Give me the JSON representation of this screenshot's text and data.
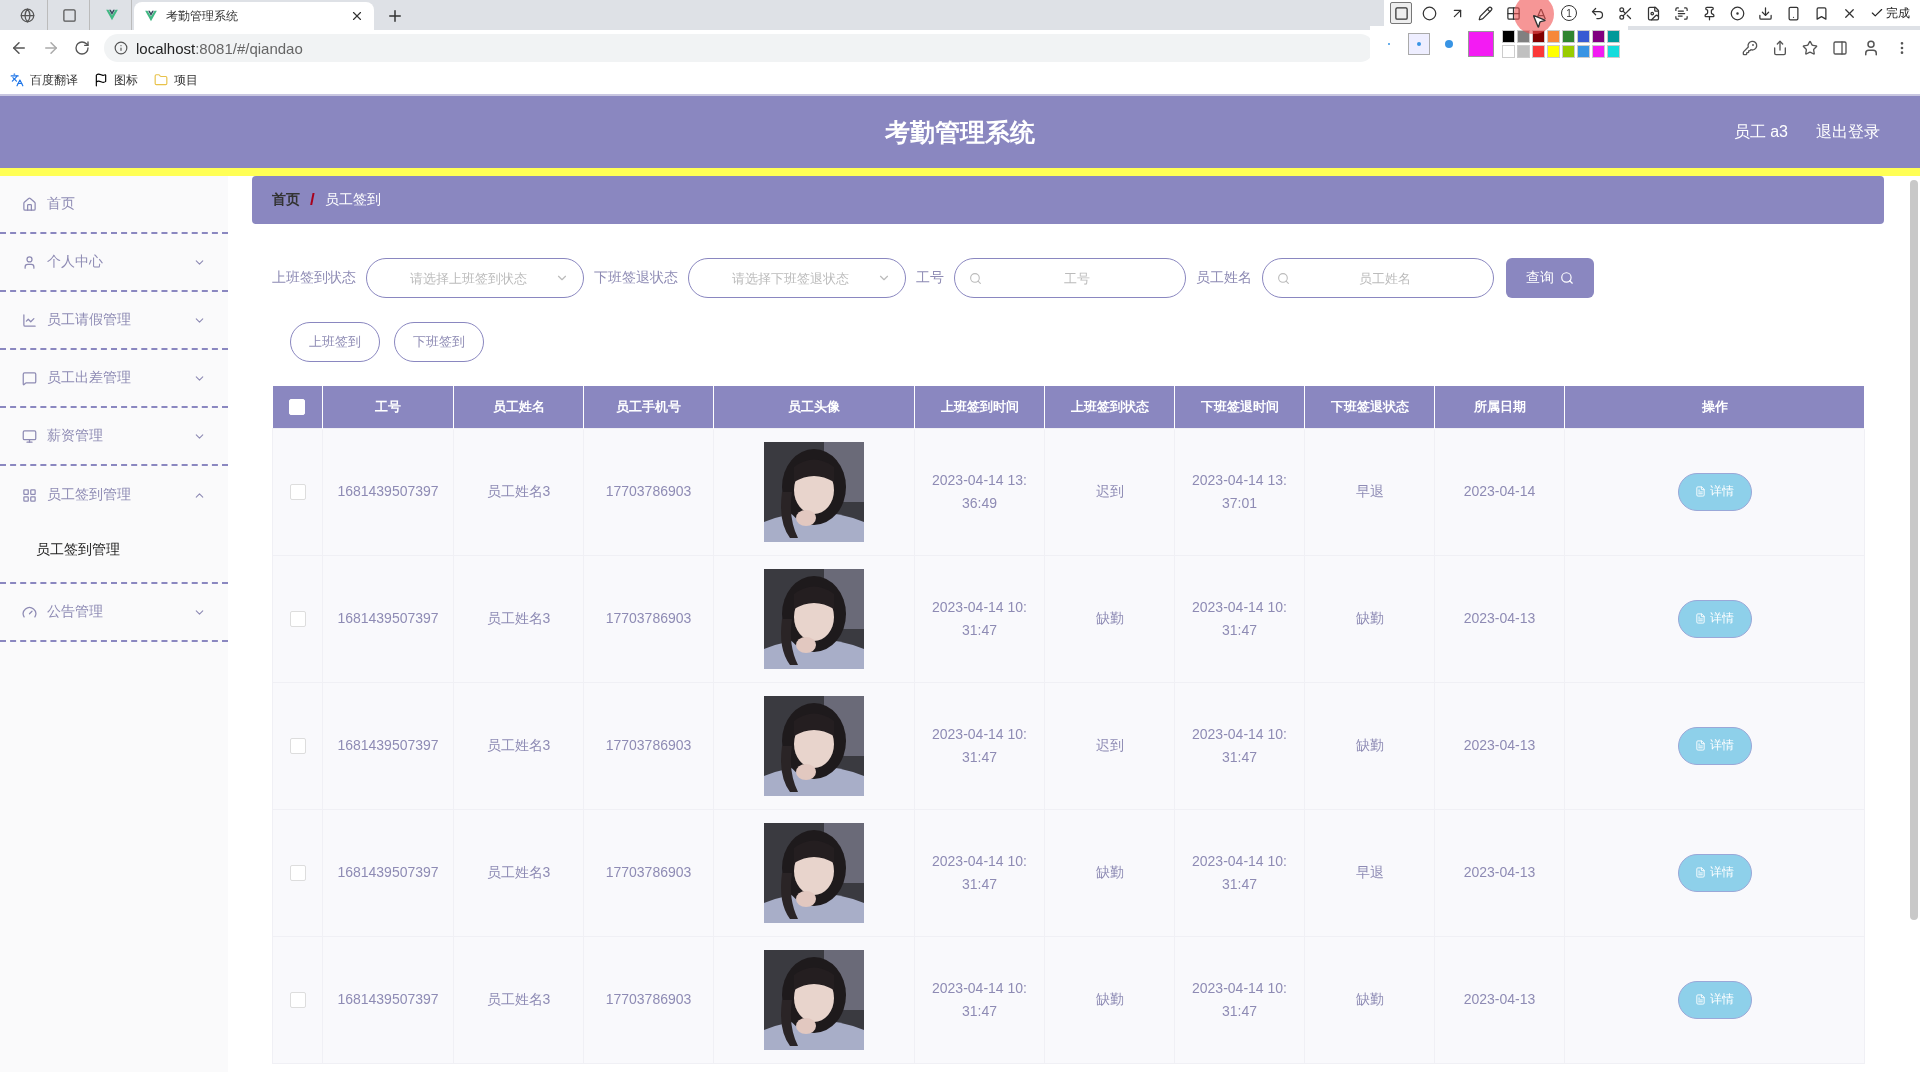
{
  "browser": {
    "tabs": [
      {
        "kind": "globe",
        "selected": false
      },
      {
        "kind": "blank",
        "selected": false
      },
      {
        "kind": "vue",
        "selected": false
      },
      {
        "kind": "vue",
        "title": "考勤管理系统",
        "selected": true
      }
    ],
    "url_host": "localhost",
    "url_rest": ":8081/#/qiandao",
    "bookmarks": [
      {
        "kind": "translate",
        "label": "百度翻译"
      },
      {
        "kind": "flag",
        "label": "图标"
      },
      {
        "kind": "folder",
        "label": "项目"
      }
    ]
  },
  "capture_tool": {
    "tools": [
      {
        "kind": "rect",
        "selected": true
      },
      {
        "kind": "circle",
        "selected": false
      },
      {
        "kind": "arrow",
        "selected": false
      },
      {
        "kind": "pen",
        "selected": false
      },
      {
        "kind": "mosaic",
        "selected": false
      },
      {
        "kind": "text",
        "glyph": "A",
        "selected": false
      },
      {
        "kind": "counter",
        "glyph": "1",
        "selected": false
      },
      {
        "kind": "undo",
        "selected": false
      },
      {
        "kind": "cut",
        "selected": false
      },
      {
        "kind": "ocr",
        "selected": false
      },
      {
        "kind": "scan",
        "selected": false
      },
      {
        "kind": "pin",
        "selected": false
      },
      {
        "kind": "record",
        "selected": false
      },
      {
        "kind": "save",
        "selected": false
      },
      {
        "kind": "phone",
        "selected": false
      },
      {
        "kind": "bookmark",
        "selected": false
      },
      {
        "kind": "close",
        "selected": false
      }
    ],
    "done_label": "完成",
    "sizes": [
      {
        "selected": false
      },
      {
        "selected": true
      },
      {
        "selected": false
      }
    ],
    "palette": [
      {
        "color": "#000000"
      },
      {
        "color": "#808080"
      },
      {
        "color": "#800000"
      },
      {
        "color": "#f7883a"
      },
      {
        "color": "#308430"
      },
      {
        "color": "#385ad3"
      },
      {
        "color": "#800080"
      },
      {
        "color": "#009999"
      },
      {
        "color": "#ffffff"
      },
      {
        "color": "#c0c0c0"
      },
      {
        "color": "#fb3838"
      },
      {
        "color": "#ffff00"
      },
      {
        "color": "#99cc00"
      },
      {
        "color": "#3894e4"
      },
      {
        "color": "#f31bf3",
        "selected": true
      },
      {
        "color": "#16dcdc"
      }
    ]
  },
  "header": {
    "title": "考勤管理系统",
    "user": "员工 a3",
    "logout": "退出登录"
  },
  "sidebar": {
    "items": [
      {
        "kind": "home",
        "label": "首页"
      },
      {
        "kind": "user",
        "label": "个人中心",
        "expanded": false
      },
      {
        "kind": "chart",
        "label": "员工请假管理",
        "expanded": false
      },
      {
        "kind": "chat",
        "label": "员工出差管理",
        "expanded": false
      },
      {
        "kind": "monitor",
        "label": "薪资管理",
        "expanded": false
      },
      {
        "kind": "grid",
        "label": "员工签到管理",
        "expanded": true,
        "children": [
          {
            "label": "员工签到管理"
          }
        ]
      },
      {
        "kind": "gauge",
        "label": "公告管理",
        "expanded": false
      }
    ]
  },
  "breadcrumb": [
    "首页",
    "员工签到"
  ],
  "breadcrumb_separator": "/",
  "filters": [
    {
      "kind": "select",
      "label": "上班签到状态",
      "placeholder": "请选择上班签到状态"
    },
    {
      "kind": "select",
      "label": "下班签退状态",
      "placeholder": "请选择下班签退状态"
    },
    {
      "kind": "search",
      "label": "工号",
      "placeholder": "工号"
    },
    {
      "kind": "search",
      "label": "员工姓名",
      "placeholder": "员工姓名"
    }
  ],
  "query_button": "查询",
  "actions": [
    "上班签到",
    "下班签到"
  ],
  "table": {
    "header_checked": false,
    "columns": [
      "工号",
      "员工姓名",
      "员工手机号",
      "员工头像",
      "上班签到时间",
      "上班签到状态",
      "下班签退时间",
      "下班签退状态",
      "所属日期",
      "操作"
    ],
    "rows": [
      {
        "checked": false,
        "id": "1681439507397",
        "name": "员工姓名3",
        "phone": "17703786903",
        "in_time": "2023-04-14 13:36:49",
        "in_status": "迟到",
        "out_time": "2023-04-14 13:37:01",
        "out_status": "早退",
        "date": "2023-04-14",
        "action": "详情"
      },
      {
        "checked": false,
        "id": "1681439507397",
        "name": "员工姓名3",
        "phone": "17703786903",
        "in_time": "2023-04-14 10:31:47",
        "in_status": "缺勤",
        "out_time": "2023-04-14 10:31:47",
        "out_status": "缺勤",
        "date": "2023-04-13",
        "action": "详情"
      },
      {
        "checked": false,
        "id": "1681439507397",
        "name": "员工姓名3",
        "phone": "17703786903",
        "in_time": "2023-04-14 10:31:47",
        "in_status": "迟到",
        "out_time": "2023-04-14 10:31:47",
        "out_status": "缺勤",
        "date": "2023-04-13",
        "action": "详情"
      },
      {
        "checked": false,
        "id": "1681439507397",
        "name": "员工姓名3",
        "phone": "17703786903",
        "in_time": "2023-04-14 10:31:47",
        "in_status": "缺勤",
        "out_time": "2023-04-14 10:31:47",
        "out_status": "早退",
        "date": "2023-04-13",
        "action": "详情"
      },
      {
        "checked": false,
        "id": "1681439507397",
        "name": "员工姓名3",
        "phone": "17703786903",
        "in_time": "2023-04-14 10:31:47",
        "in_status": "缺勤",
        "out_time": "2023-04-14 10:31:47",
        "out_status": "缺勤",
        "date": "2023-04-13",
        "action": "详情"
      }
    ]
  }
}
